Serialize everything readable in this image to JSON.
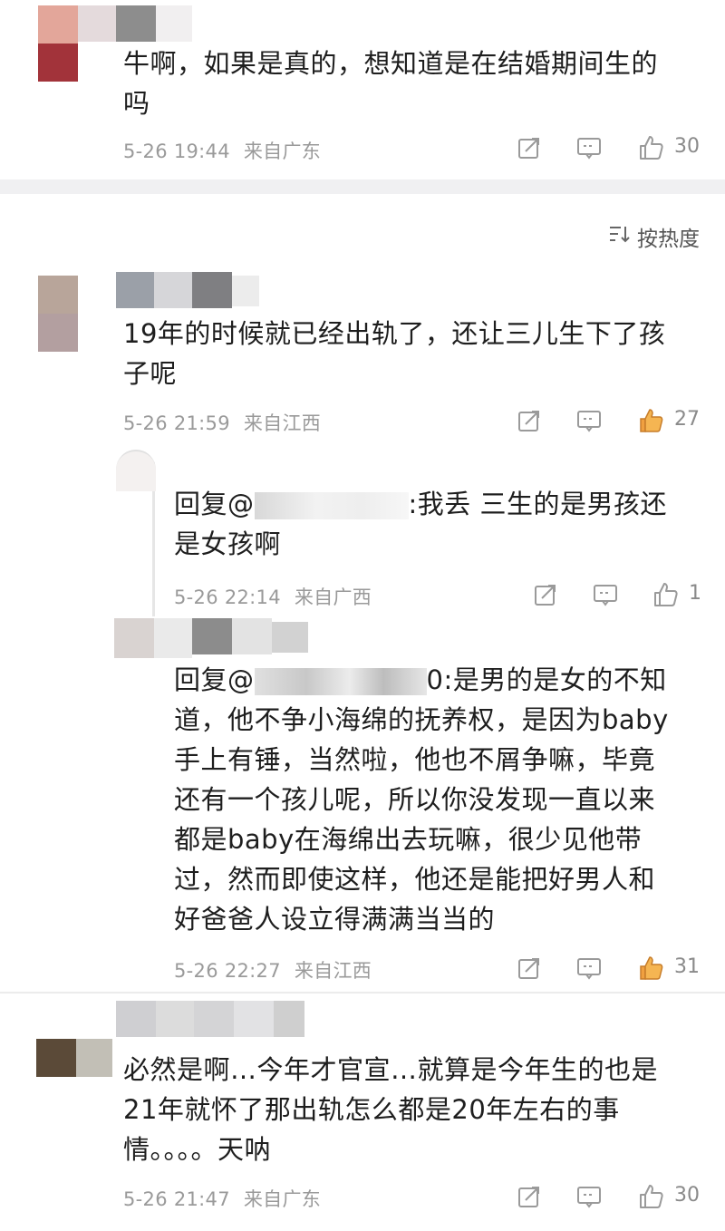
{
  "top_comment": {
    "text_line1": "牛啊，如果是真的，想知道是在结婚期间生的",
    "text_line2": "吗",
    "time": "5-26 19:44",
    "location": "来自广东",
    "likes": "30"
  },
  "sort": {
    "label": "按热度",
    "icon": "sort-icon"
  },
  "comments": [
    {
      "text_line1": "19年的时候就已经出轨了，还让三儿生下了孩",
      "text_line2": "子呢",
      "time": "5-26 21:59",
      "location": "来自江西",
      "likes": "27",
      "liked": true
    },
    {
      "text_line1": "必然是啊…今年才官宣…就算是今年生的也是",
      "text_line2": "21年就怀了那出轨怎么都是20年左右的事",
      "text_line3": "情。。。。天呐",
      "time": "5-26 21:47",
      "location": "来自广东",
      "likes": "30",
      "liked": false
    }
  ],
  "replies": [
    {
      "prefix": "回复@",
      "handle_tail": ":我丢 三生的是男孩还",
      "line2": "是女孩啊",
      "time": "5-26 22:14",
      "location": "来自广西",
      "likes": "1",
      "liked": false
    },
    {
      "prefix": "回复@",
      "handle_tail": "0:是男的是女的不知",
      "lines": [
        "道，他不争小海绵的抚养权，是因为baby",
        "手上有锤，当然啦，他也不屑争嘛，毕竟",
        "还有一个孩儿呢，所以你没发现一直以来",
        "都是baby在海绵出去玩嘛，很少见他带",
        "过，然而即使这样，他还是能把好男人和",
        "好爸爸人设立得满满当当的"
      ],
      "time": "5-26 22:27",
      "location": "来自江西",
      "likes": "31",
      "liked": true
    }
  ],
  "colors": {
    "liked": "#f0a040",
    "icon": "#9a9a9a",
    "meta": "#9a9a9a"
  }
}
